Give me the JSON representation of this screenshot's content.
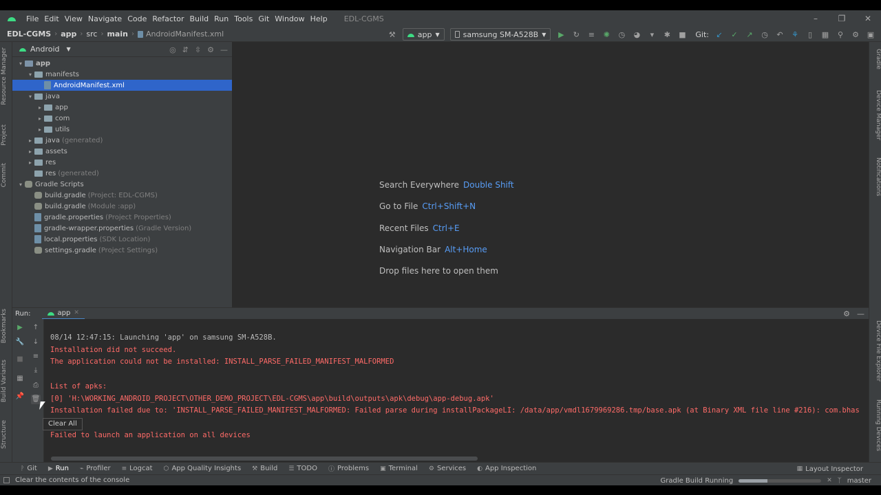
{
  "window": {
    "title": "EDL-CGMS"
  },
  "menu": [
    "File",
    "Edit",
    "View",
    "Navigate",
    "Code",
    "Refactor",
    "Build",
    "Run",
    "Tools",
    "Git",
    "Window",
    "Help"
  ],
  "breadcrumbs": [
    "EDL-CGMS",
    "app",
    "src",
    "main",
    "AndroidManifest.xml"
  ],
  "toolbar": {
    "run_config": "app",
    "device": "samsung SM-A528B",
    "git_label": "Git:"
  },
  "project": {
    "view_mode": "Android",
    "tree": [
      {
        "label": "app",
        "hint": "",
        "depth": 0,
        "arrow": "down",
        "icon": "module",
        "selected": false
      },
      {
        "label": "manifests",
        "hint": "",
        "depth": 1,
        "arrow": "down",
        "icon": "folder",
        "selected": false
      },
      {
        "label": "AndroidManifest.xml",
        "hint": "",
        "depth": 2,
        "arrow": "",
        "icon": "file",
        "selected": true
      },
      {
        "label": "java",
        "hint": "",
        "depth": 1,
        "arrow": "down",
        "icon": "folder",
        "selected": false
      },
      {
        "label": "app",
        "hint": "",
        "depth": 2,
        "arrow": "right",
        "icon": "folder",
        "selected": false
      },
      {
        "label": "com",
        "hint": "",
        "depth": 2,
        "arrow": "right",
        "icon": "folder",
        "selected": false
      },
      {
        "label": "utils",
        "hint": "",
        "depth": 2,
        "arrow": "right",
        "icon": "folder",
        "selected": false
      },
      {
        "label": "java",
        "hint": "(generated)",
        "depth": 1,
        "arrow": "right",
        "icon": "folder",
        "selected": false
      },
      {
        "label": "assets",
        "hint": "",
        "depth": 1,
        "arrow": "right",
        "icon": "folder",
        "selected": false
      },
      {
        "label": "res",
        "hint": "",
        "depth": 1,
        "arrow": "right",
        "icon": "folder",
        "selected": false
      },
      {
        "label": "res",
        "hint": "(generated)",
        "depth": 1,
        "arrow": "",
        "icon": "folder",
        "selected": false
      },
      {
        "label": "Gradle Scripts",
        "hint": "",
        "depth": 0,
        "arrow": "down",
        "icon": "gradle",
        "selected": false
      },
      {
        "label": "build.gradle",
        "hint": "(Project: EDL-CGMS)",
        "depth": 1,
        "arrow": "",
        "icon": "gradle",
        "selected": false
      },
      {
        "label": "build.gradle",
        "hint": "(Module :app)",
        "depth": 1,
        "arrow": "",
        "icon": "gradle",
        "selected": false
      },
      {
        "label": "gradle.properties",
        "hint": "(Project Properties)",
        "depth": 1,
        "arrow": "",
        "icon": "file",
        "selected": false
      },
      {
        "label": "gradle-wrapper.properties",
        "hint": "(Gradle Version)",
        "depth": 1,
        "arrow": "",
        "icon": "file",
        "selected": false
      },
      {
        "label": "local.properties",
        "hint": "(SDK Location)",
        "depth": 1,
        "arrow": "",
        "icon": "file",
        "selected": false
      },
      {
        "label": "settings.gradle",
        "hint": "(Project Settings)",
        "depth": 1,
        "arrow": "",
        "icon": "gradle",
        "selected": false
      }
    ]
  },
  "editor": {
    "welcome": [
      {
        "text": "Search Everywhere",
        "key": "Double Shift"
      },
      {
        "text": "Go to File",
        "key": "Ctrl+Shift+N"
      },
      {
        "text": "Recent Files",
        "key": "Ctrl+E"
      },
      {
        "text": "Navigation Bar",
        "key": "Alt+Home"
      },
      {
        "text": "Drop files here to open them",
        "key": ""
      }
    ]
  },
  "run": {
    "label": "Run:",
    "tab": "app",
    "console": [
      {
        "text": "08/14 12:47:15: Launching 'app' on samsung SM-A528B.",
        "error": false
      },
      {
        "text": "Installation did not succeed.",
        "error": true
      },
      {
        "text": "The application could not be installed: INSTALL_PARSE_FAILED_MANIFEST_MALFORMED",
        "error": true
      },
      {
        "text": "",
        "error": true
      },
      {
        "text": "List of apks:",
        "error": true
      },
      {
        "text": "[0] 'H:\\WORKING_ANDROID_PROJECT\\OTHER_DEMO_PROJECT\\EDL-CGMS\\app\\build\\outputs\\apk\\debug\\app-debug.apk'",
        "error": true
      },
      {
        "text": "Installation failed due to: 'INSTALL_PARSE_FAILED_MANIFEST_MALFORMED: Failed parse during installPackageLI: /data/app/vmdl1679969286.tmp/base.apk (at Binary XML file line #216): com.bhas",
        "error": true
      },
      {
        "text": "",
        "error": true
      },
      {
        "text": "Failed to launch an application on all devices",
        "error": true
      }
    ],
    "tooltip": "Clear All"
  },
  "left_strip": [
    "Resource Manager",
    "Project",
    "Commit",
    "Bookmarks",
    "Build Variants",
    "Structure"
  ],
  "right_strip": [
    "Gradle",
    "Device Manager",
    "Notifications",
    "Device File Explorer",
    "Running Devices"
  ],
  "bottom_tools": [
    {
      "label": "Git",
      "icon": "git-icon",
      "active": false
    },
    {
      "label": "Run",
      "icon": "run-icon",
      "active": true
    },
    {
      "label": "Profiler",
      "icon": "profiler-icon",
      "active": false
    },
    {
      "label": "Logcat",
      "icon": "logcat-icon",
      "active": false
    },
    {
      "label": "App Quality Insights",
      "icon": "insights-icon",
      "active": false
    },
    {
      "label": "Build",
      "icon": "build-icon",
      "active": false
    },
    {
      "label": "TODO",
      "icon": "todo-icon",
      "active": false
    },
    {
      "label": "Problems",
      "icon": "problems-icon",
      "active": false
    },
    {
      "label": "Terminal",
      "icon": "terminal-icon",
      "active": false
    },
    {
      "label": "Services",
      "icon": "services-icon",
      "active": false
    },
    {
      "label": "App Inspection",
      "icon": "inspection-icon",
      "active": false
    }
  ],
  "layout_inspector": "Layout Inspector",
  "status": {
    "message": "Clear the contents of the console",
    "task": "Gradle Build Running",
    "progress": 0.35,
    "branch": "master"
  },
  "colors": {
    "accent": "#2f65ca",
    "error_text": "#ff6b68",
    "link_key": "#589df6",
    "run_green": "#59a869"
  }
}
